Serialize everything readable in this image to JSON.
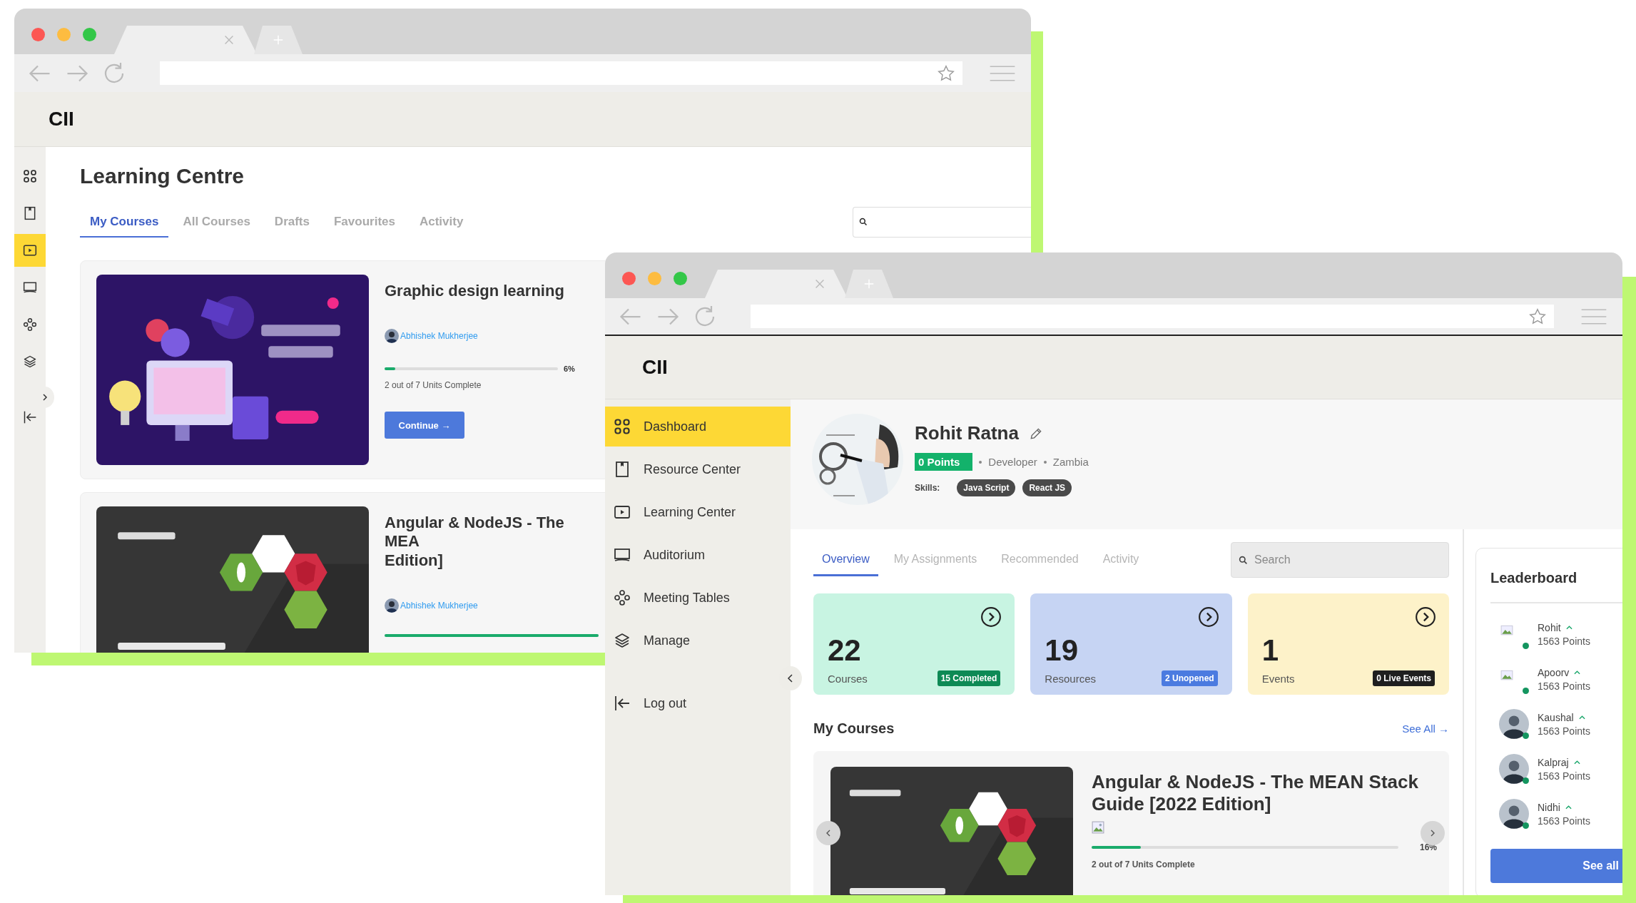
{
  "back_window": {
    "logo": "CII",
    "sidebar": [
      {
        "selected": false
      },
      {
        "selected": false
      },
      {
        "selected": true
      },
      {
        "selected": false
      },
      {
        "selected": false
      },
      {
        "selected": false
      }
    ],
    "page_title": "Learning Centre",
    "tabs": [
      {
        "label": "My Courses",
        "selected": true
      },
      {
        "label": "All Courses",
        "selected": false
      },
      {
        "label": "Drafts",
        "selected": false
      },
      {
        "label": "Favourites",
        "selected": false
      },
      {
        "label": "Activity",
        "selected": false
      }
    ],
    "courses": [
      {
        "title": "Graphic design learning",
        "author": "Abhishek Mukherjee",
        "level": 0.06,
        "percent": "6%",
        "units": "2 out of 7 Units Complete",
        "button": "Continue →"
      },
      {
        "title": "Angular & NodeJS - The MEA\nEdition]",
        "author": "Abhishek Mukherjee",
        "level": 1
      }
    ]
  },
  "front_window": {
    "logo": "CII",
    "sidebar": [
      {
        "label": "Dashboard",
        "selected": true
      },
      {
        "label": "Resource Center",
        "selected": false
      },
      {
        "label": "Learning Center",
        "selected": false
      },
      {
        "label": "Auditorium",
        "selected": false
      },
      {
        "label": "Meeting Tables",
        "selected": false
      },
      {
        "label": "Manage",
        "selected": false
      }
    ],
    "logout": "Log out",
    "profile": {
      "name": "Rohit Ratna",
      "points": "0 Points",
      "role": "Developer",
      "country": "Zambia",
      "skills_label": "Skills:",
      "skills": [
        "Java Script",
        "React JS"
      ]
    },
    "tabs": [
      {
        "label": "Overview",
        "selected": true
      },
      {
        "label": "My Assignments",
        "selected": false
      },
      {
        "label": "Recommended",
        "selected": false
      },
      {
        "label": "Activity",
        "selected": false
      }
    ],
    "search": {
      "placeholder": "Search"
    },
    "stats": [
      {
        "value": "22",
        "label": "Courses",
        "badge": "15 Completed",
        "color": "#c8f4e2"
      },
      {
        "value": "19",
        "label": "Resources",
        "badge": "2 Unopened",
        "color": "#c6d4f3"
      },
      {
        "value": "1",
        "label": "Events",
        "badge": "0 Live Events",
        "color": "#fdf2c9"
      }
    ],
    "my_courses": {
      "title": "My Courses",
      "see_all": "See All →",
      "course": {
        "title": "Angular & NodeJS - The MEAN Stack Guide [2022 Edition]",
        "level": 0.16,
        "percent": "16%",
        "units": "2 out of 7 Units Complete"
      }
    },
    "leaderboard": {
      "title": "Leaderboard",
      "entries": [
        {
          "name": "Rohit",
          "points": "1563 Points",
          "online": true,
          "kind": "broken"
        },
        {
          "name": "Apoorv",
          "points": "1563 Points",
          "online": true,
          "kind": "broken"
        },
        {
          "name": "Kaushal",
          "points": "1563 Points",
          "online": true
        },
        {
          "name": "Kalpraj",
          "points": "1563 Points",
          "online": true
        },
        {
          "name": "Nidhi",
          "points": "1563 Points",
          "online": true
        }
      ],
      "button": "See all"
    }
  }
}
